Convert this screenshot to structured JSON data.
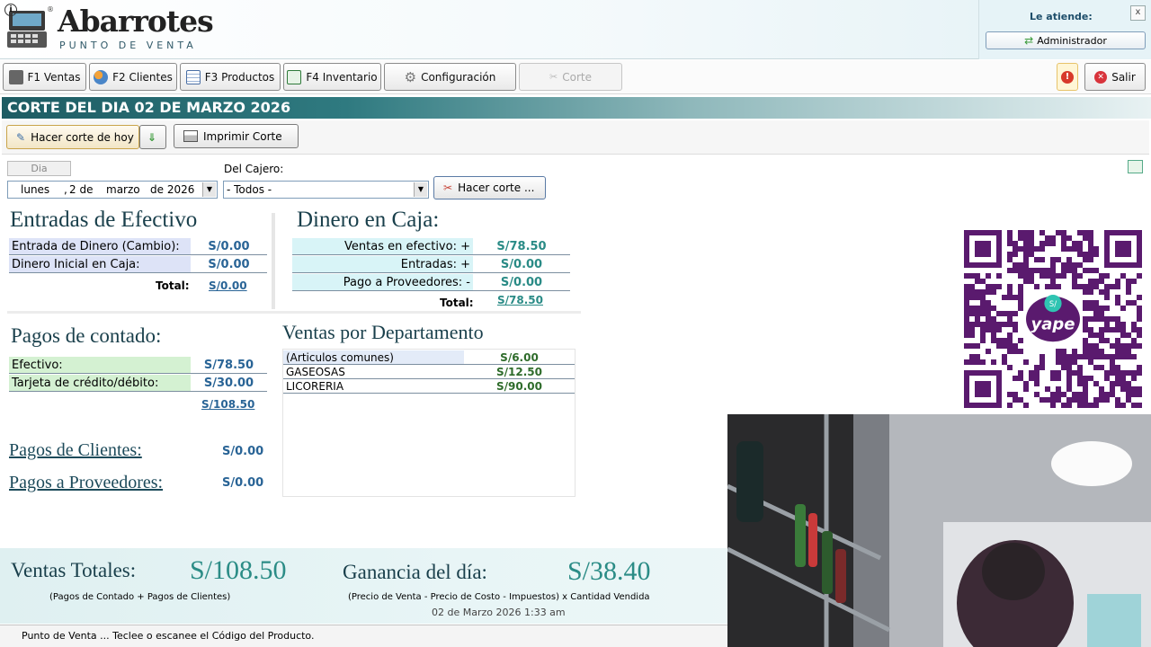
{
  "app": {
    "logo_title": "Abarrotes",
    "logo_reg": "®",
    "logo_subtitle": "PUNTO DE VENTA",
    "attend_label": "Le atiende:",
    "user": "Administrador",
    "close_glyph": "x"
  },
  "toolbar": {
    "ventas": "F1 Ventas",
    "clientes": "F2 Clientes",
    "productos": "F3 Productos",
    "inventario": "F4 Inventario",
    "configuracion": "Configuración",
    "corte": "Corte",
    "salir": "Salir"
  },
  "section_title": "CORTE DEL DIA 02 DE MARZO 2026",
  "actions": {
    "hacer_corte_hoy": "Hacer corte de hoy",
    "imprimir": "Imprimir Corte",
    "hacer_corte": "Hacer corte ..."
  },
  "filters": {
    "dia_tab": "Dia",
    "weekday": "lunes",
    "comma": ",",
    "day": "2 de",
    "month": "marzo",
    "year": "de 2026",
    "cajero_label": "Del Cajero:",
    "cajero_value": "- Todos -"
  },
  "entradas": {
    "title": "Entradas de Efectivo",
    "rows": [
      {
        "label": "Entrada de Dinero (Cambio):",
        "value": "S/0.00"
      },
      {
        "label": "Dinero Inicial en Caja:",
        "value": "S/0.00"
      }
    ],
    "total_label": "Total:",
    "total_value": "S/0.00"
  },
  "caja": {
    "title": "Dinero en Caja:",
    "rows": [
      {
        "label": "Ventas en efectivo: +",
        "value": "S/78.50"
      },
      {
        "label": "Entradas: +",
        "value": "S/0.00"
      },
      {
        "label": "Pago a Proveedores: -",
        "value": "S/0.00"
      }
    ],
    "total_label": "Total:",
    "total_value": "S/78.50"
  },
  "contado": {
    "title": "Pagos de contado:",
    "rows": [
      {
        "label": "Efectivo:",
        "value": "S/78.50"
      },
      {
        "label": "Tarjeta de crédito/débito:",
        "value": "S/30.00"
      }
    ],
    "total_value": "S/108.50"
  },
  "departamentos": {
    "title": "Ventas por Departamento",
    "rows": [
      {
        "label": "(Articulos comunes)",
        "value": "S/6.00"
      },
      {
        "label": "GASEOSAS",
        "value": "S/12.50"
      },
      {
        "label": "LICORERIA",
        "value": "S/90.00"
      }
    ]
  },
  "pagos_clientes": {
    "label": "Pagos de Clientes:",
    "value": "S/0.00"
  },
  "pagos_proveedores": {
    "label": "Pagos a Proveedores:",
    "value": "S/0.00"
  },
  "totales": {
    "ventas_label": "Ventas Totales:",
    "ventas_value": "S/108.50",
    "ventas_note": "(Pagos de Contado + Pagos de Clientes)",
    "ganancia_label": "Ganancia del día:",
    "ganancia_value": "S/38.40",
    "ganancia_note": "(Precio de Venta - Precio de Costo - Impuestos) x Cantidad Vendida",
    "timestamp": "02 de Marzo 2026 1:33 am"
  },
  "status": "Punto de Venta ... Teclee o escanee el Código del Producto.",
  "qr": {
    "badge": "S/",
    "brand": "yape"
  },
  "colors": {
    "title_bar": "#1e5c63",
    "qr_purple": "#5a1a6e",
    "value_blue": "#296496",
    "value_teal": "#2a8b86",
    "total_green": "#2a8b86"
  }
}
